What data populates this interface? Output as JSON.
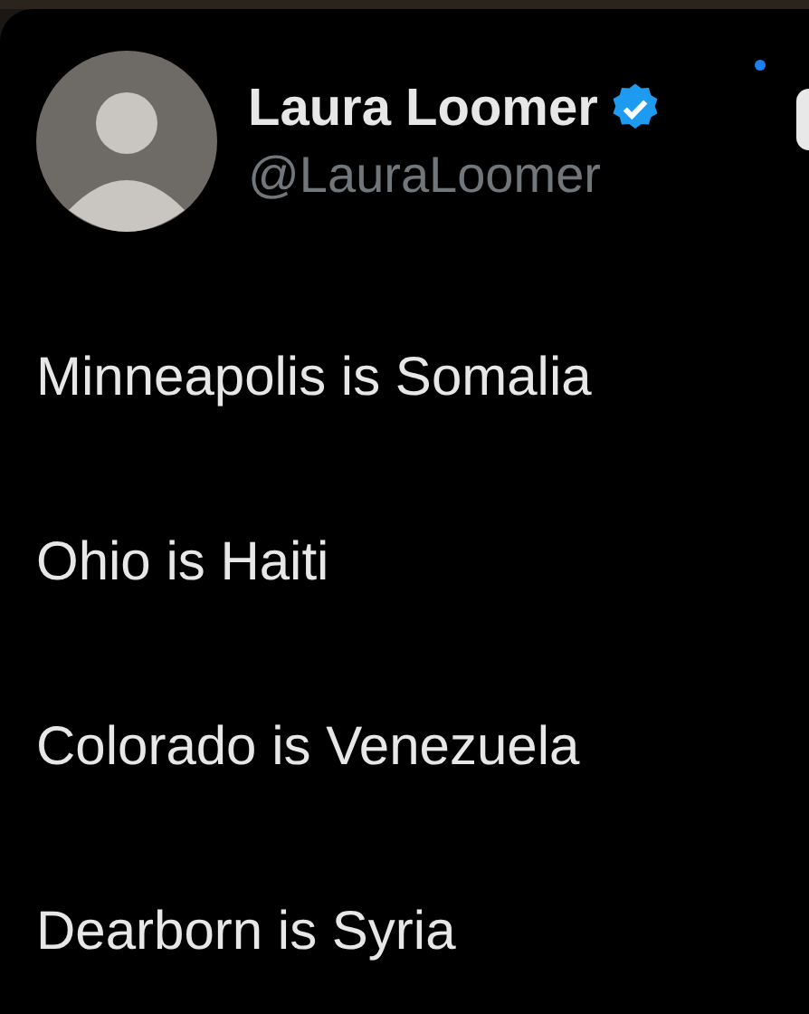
{
  "author": {
    "name": "Laura Loomer",
    "handle": "@LauraLoomer",
    "verified": true
  },
  "lines": [
    "Minneapolis is Somalia",
    "Ohio is Haiti",
    "Colorado is Venezuela",
    "Dearborn is Syria"
  ]
}
